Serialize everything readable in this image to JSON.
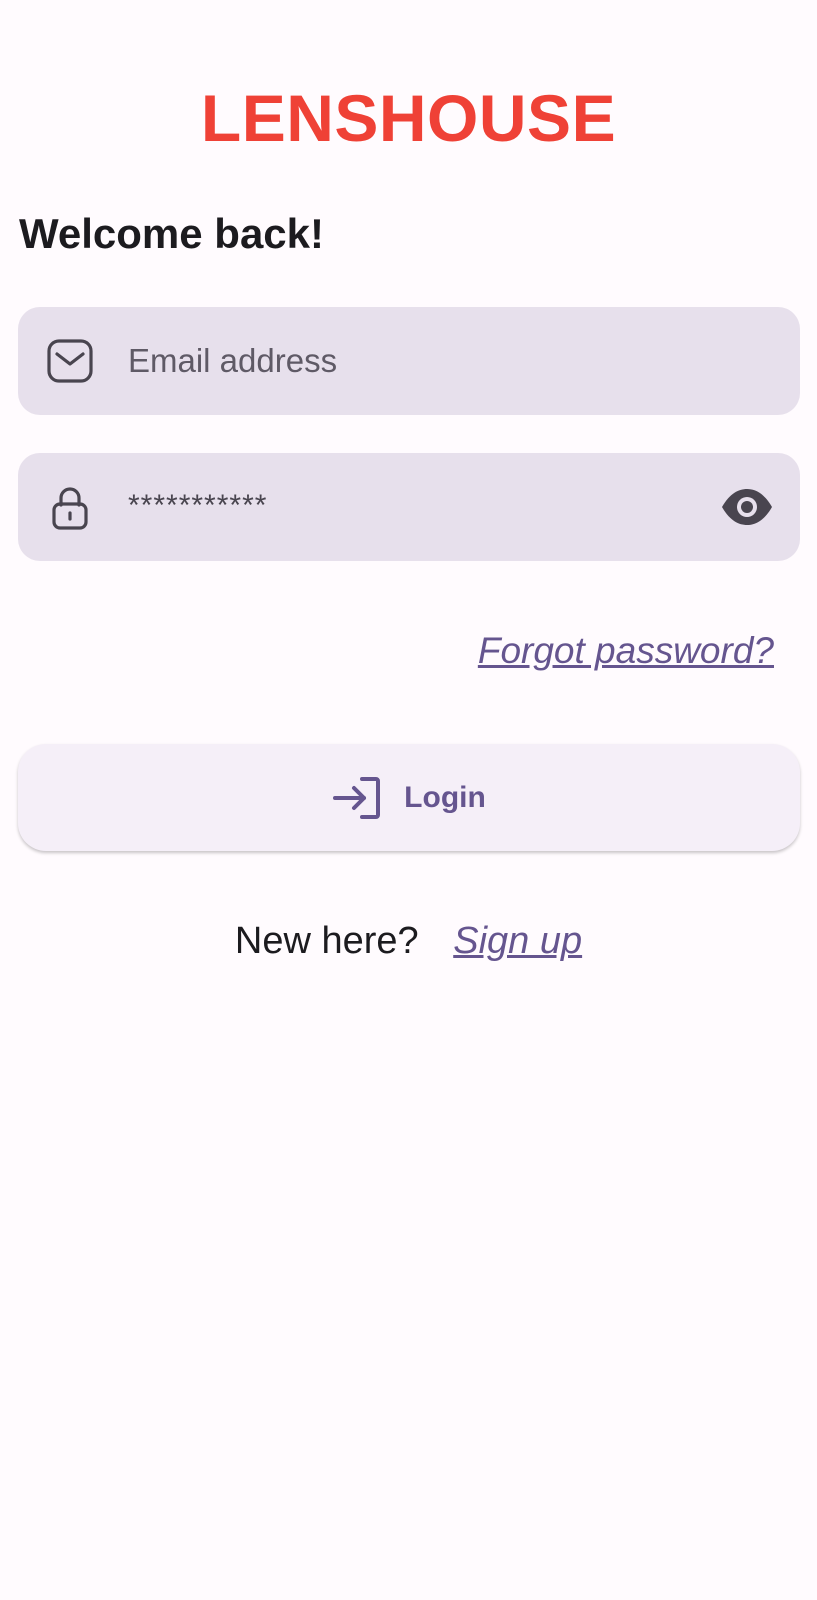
{
  "brand": {
    "name": "LENSHOUSE",
    "color": "#ef4136"
  },
  "heading": {
    "welcome": "Welcome back!"
  },
  "email_field": {
    "icon": "mail-icon",
    "placeholder": "Email address",
    "value": ""
  },
  "password_field": {
    "icon": "lock-icon",
    "masked_value": "***********",
    "toggle_icon": "eye-icon"
  },
  "links": {
    "forgot_password": "Forgot password?"
  },
  "login_button": {
    "icon": "login-arrow-icon",
    "label": "Login"
  },
  "signup": {
    "prompt": "New here?",
    "link": "Sign up"
  },
  "colors": {
    "accent": "#65558f",
    "field_bg": "#e7e0ec",
    "button_bg": "#f5eff8"
  }
}
